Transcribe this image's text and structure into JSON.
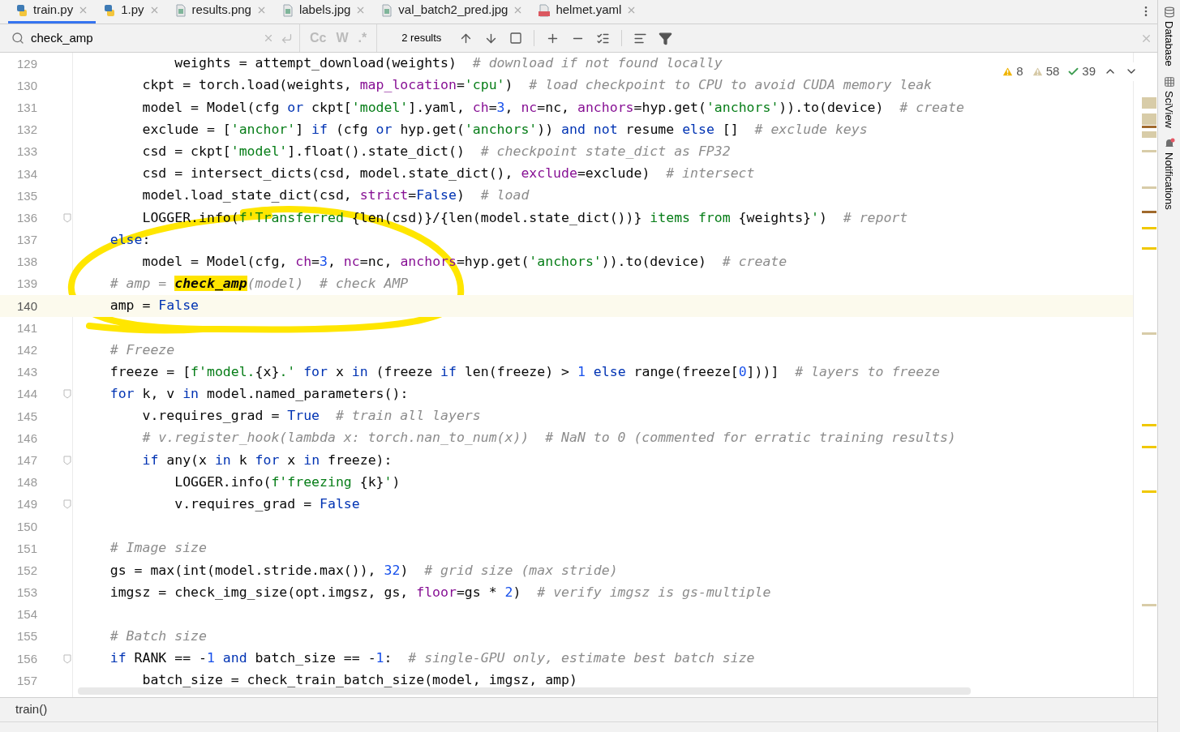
{
  "tabs": [
    {
      "label": "train.py",
      "kind": "python",
      "selected": true
    },
    {
      "label": "1.py",
      "kind": "python",
      "selected": false
    },
    {
      "label": "results.png",
      "kind": "image",
      "selected": false
    },
    {
      "label": "labels.jpg",
      "kind": "image",
      "selected": false
    },
    {
      "label": "val_batch2_pred.jpg",
      "kind": "image",
      "selected": false
    },
    {
      "label": "helmet.yaml",
      "kind": "yaml",
      "selected": false
    }
  ],
  "search": {
    "value": "check_amp",
    "options": [
      "Cc",
      "W",
      ".*"
    ],
    "results": "2 results"
  },
  "inspections": [
    {
      "kind": "warning",
      "count": "8"
    },
    {
      "kind": "weak-warning",
      "count": "58"
    },
    {
      "kind": "typo",
      "count": "39"
    }
  ],
  "lines": [
    {
      "number": "129",
      "current": false,
      "fold": false,
      "tokens": [
        {
          "kind": "plain",
          "text": "            weights = attempt_download(weights)  "
        },
        {
          "kind": "comment",
          "text": "# download if not found locally"
        }
      ]
    },
    {
      "number": "130",
      "current": false,
      "fold": false,
      "tokens": [
        {
          "kind": "plain",
          "text": "        ckpt = torch.load(weights, "
        },
        {
          "kind": "param",
          "text": "map_location"
        },
        {
          "kind": "plain",
          "text": "="
        },
        {
          "kind": "str",
          "text": "'cpu'"
        },
        {
          "kind": "plain",
          "text": ")  "
        },
        {
          "kind": "comment",
          "text": "# load checkpoint to CPU to avoid CUDA memory leak"
        }
      ]
    },
    {
      "number": "131",
      "current": false,
      "fold": false,
      "tokens": [
        {
          "kind": "plain",
          "text": "        model = Model(cfg "
        },
        {
          "kind": "kw",
          "text": "or"
        },
        {
          "kind": "plain",
          "text": " ckpt["
        },
        {
          "kind": "str",
          "text": "'model'"
        },
        {
          "kind": "plain",
          "text": "].yaml, "
        },
        {
          "kind": "param",
          "text": "ch"
        },
        {
          "kind": "plain",
          "text": "="
        },
        {
          "kind": "num",
          "text": "3"
        },
        {
          "kind": "plain",
          "text": ", "
        },
        {
          "kind": "param",
          "text": "nc"
        },
        {
          "kind": "plain",
          "text": "=nc, "
        },
        {
          "kind": "param",
          "text": "anchors"
        },
        {
          "kind": "plain",
          "text": "=hyp.get("
        },
        {
          "kind": "str",
          "text": "'anchors'"
        },
        {
          "kind": "plain",
          "text": ")).to(device)  "
        },
        {
          "kind": "comment",
          "text": "# create"
        }
      ]
    },
    {
      "number": "132",
      "current": false,
      "fold": false,
      "tokens": [
        {
          "kind": "plain",
          "text": "        exclude = ["
        },
        {
          "kind": "str",
          "text": "'anchor'"
        },
        {
          "kind": "plain",
          "text": "] "
        },
        {
          "kind": "kw",
          "text": "if"
        },
        {
          "kind": "plain",
          "text": " (cfg "
        },
        {
          "kind": "kw",
          "text": "or"
        },
        {
          "kind": "plain",
          "text": " hyp.get("
        },
        {
          "kind": "str",
          "text": "'anchors'"
        },
        {
          "kind": "plain",
          "text": ")) "
        },
        {
          "kind": "kw",
          "text": "and not"
        },
        {
          "kind": "plain",
          "text": " resume "
        },
        {
          "kind": "kw",
          "text": "else"
        },
        {
          "kind": "plain",
          "text": " []  "
        },
        {
          "kind": "comment",
          "text": "# exclude keys"
        }
      ]
    },
    {
      "number": "133",
      "current": false,
      "fold": false,
      "tokens": [
        {
          "kind": "plain",
          "text": "        csd = ckpt["
        },
        {
          "kind": "str",
          "text": "'model'"
        },
        {
          "kind": "plain",
          "text": "].float().state_dict()  "
        },
        {
          "kind": "comment",
          "text": "# checkpoint state_dict as FP32"
        }
      ]
    },
    {
      "number": "134",
      "current": false,
      "fold": false,
      "tokens": [
        {
          "kind": "plain",
          "text": "        csd = intersect_dicts(csd, model.state_dict(), "
        },
        {
          "kind": "param",
          "text": "exclude"
        },
        {
          "kind": "plain",
          "text": "=exclude)  "
        },
        {
          "kind": "comment",
          "text": "# intersect"
        }
      ]
    },
    {
      "number": "135",
      "current": false,
      "fold": false,
      "tokens": [
        {
          "kind": "plain",
          "text": "        model.load_state_dict(csd, "
        },
        {
          "kind": "param",
          "text": "strict"
        },
        {
          "kind": "plain",
          "text": "="
        },
        {
          "kind": "kw",
          "text": "False"
        },
        {
          "kind": "plain",
          "text": ")  "
        },
        {
          "kind": "comment",
          "text": "# load"
        }
      ]
    },
    {
      "number": "136",
      "current": false,
      "fold": true,
      "tokens": [
        {
          "kind": "plain",
          "text": "        LOGGER.info("
        },
        {
          "kind": "str",
          "text": "f'Transferred "
        },
        {
          "kind": "plain",
          "text": "{len(csd)}/{len(model.state_dict())}"
        },
        {
          "kind": "str",
          "text": " items from "
        },
        {
          "kind": "plain",
          "text": "{weights}"
        },
        {
          "kind": "str",
          "text": "'"
        },
        {
          "kind": "plain",
          "text": ")  "
        },
        {
          "kind": "comment",
          "text": "# report"
        }
      ]
    },
    {
      "number": "137",
      "current": false,
      "fold": false,
      "tokens": [
        {
          "kind": "kw",
          "text": "    else"
        },
        {
          "kind": "plain",
          "text": ":"
        }
      ]
    },
    {
      "number": "138",
      "current": false,
      "fold": false,
      "tokens": [
        {
          "kind": "plain",
          "text": "        model = Model(cfg, "
        },
        {
          "kind": "param",
          "text": "ch"
        },
        {
          "kind": "plain",
          "text": "="
        },
        {
          "kind": "num",
          "text": "3"
        },
        {
          "kind": "plain",
          "text": ", "
        },
        {
          "kind": "param",
          "text": "nc"
        },
        {
          "kind": "plain",
          "text": "=nc, "
        },
        {
          "kind": "param",
          "text": "anchors"
        },
        {
          "kind": "plain",
          "text": "=hyp.get("
        },
        {
          "kind": "str",
          "text": "'anchors'"
        },
        {
          "kind": "plain",
          "text": ")).to(device)  "
        },
        {
          "kind": "comment",
          "text": "# create"
        }
      ]
    },
    {
      "number": "139",
      "current": false,
      "fold": false,
      "tokens": [
        {
          "kind": "comment",
          "text": "    # amp = "
        },
        {
          "kind": "match",
          "text": "check_amp"
        },
        {
          "kind": "comment",
          "text": "(model)  # check AMP"
        }
      ]
    },
    {
      "number": "140",
      "current": true,
      "fold": false,
      "tokens": [
        {
          "kind": "plain",
          "text": "    amp = "
        },
        {
          "kind": "kw",
          "text": "False"
        }
      ]
    },
    {
      "number": "141",
      "current": false,
      "fold": false
    },
    {
      "number": "142",
      "current": false,
      "fold": false,
      "tokens": [
        {
          "kind": "comment",
          "text": "    # Freeze"
        }
      ]
    },
    {
      "number": "143",
      "current": false,
      "fold": false,
      "tokens": [
        {
          "kind": "plain",
          "text": "    freeze = ["
        },
        {
          "kind": "str",
          "text": "f'model."
        },
        {
          "kind": "plain",
          "text": "{x}"
        },
        {
          "kind": "str",
          "text": ".'"
        },
        {
          "kind": "kw",
          "text": " for"
        },
        {
          "kind": "plain",
          "text": " x "
        },
        {
          "kind": "kw",
          "text": "in"
        },
        {
          "kind": "plain",
          "text": " (freeze "
        },
        {
          "kind": "kw",
          "text": "if"
        },
        {
          "kind": "plain",
          "text": " len(freeze) > "
        },
        {
          "kind": "num",
          "text": "1"
        },
        {
          "kind": "kw",
          "text": " else"
        },
        {
          "kind": "plain",
          "text": " range(freeze["
        },
        {
          "kind": "num",
          "text": "0"
        },
        {
          "kind": "plain",
          "text": "]))]  "
        },
        {
          "kind": "comment",
          "text": "# layers to freeze"
        }
      ]
    },
    {
      "number": "144",
      "current": false,
      "fold": true,
      "tokens": [
        {
          "kind": "kw",
          "text": "    for"
        },
        {
          "kind": "plain",
          "text": " k, v "
        },
        {
          "kind": "kw",
          "text": "in"
        },
        {
          "kind": "plain",
          "text": " model.named_parameters():"
        }
      ]
    },
    {
      "number": "145",
      "current": false,
      "fold": false,
      "tokens": [
        {
          "kind": "plain",
          "text": "        v.requires_grad = "
        },
        {
          "kind": "kw",
          "text": "True"
        },
        {
          "kind": "comment",
          "text": "  # train all layers"
        }
      ]
    },
    {
      "number": "146",
      "current": false,
      "fold": false,
      "tokens": [
        {
          "kind": "comment",
          "text": "        # v.register_hook(lambda x: torch.nan_to_num(x))  # NaN to 0 (commented for erratic training results)"
        }
      ]
    },
    {
      "number": "147",
      "current": false,
      "fold": true,
      "tokens": [
        {
          "kind": "kw",
          "text": "        if"
        },
        {
          "kind": "plain",
          "text": " any(x "
        },
        {
          "kind": "kw",
          "text": "in"
        },
        {
          "kind": "plain",
          "text": " k "
        },
        {
          "kind": "kw",
          "text": "for"
        },
        {
          "kind": "plain",
          "text": " x "
        },
        {
          "kind": "kw",
          "text": "in"
        },
        {
          "kind": "plain",
          "text": " freeze):"
        }
      ]
    },
    {
      "number": "148",
      "current": false,
      "fold": false,
      "tokens": [
        {
          "kind": "plain",
          "text": "            LOGGER.info("
        },
        {
          "kind": "str",
          "text": "f'freezing "
        },
        {
          "kind": "plain",
          "text": "{k}"
        },
        {
          "kind": "str",
          "text": "'"
        },
        {
          "kind": "plain",
          "text": ")"
        }
      ]
    },
    {
      "number": "149",
      "current": false,
      "fold": true,
      "tokens": [
        {
          "kind": "plain",
          "text": "            v.requires_grad = "
        },
        {
          "kind": "kw",
          "text": "False"
        }
      ]
    },
    {
      "number": "150",
      "current": false,
      "fold": false
    },
    {
      "number": "151",
      "current": false,
      "fold": false,
      "tokens": [
        {
          "kind": "comment",
          "text": "    # Image size"
        }
      ]
    },
    {
      "number": "152",
      "current": false,
      "fold": false,
      "tokens": [
        {
          "kind": "plain",
          "text": "    gs = max(int(model.stride.max()), "
        },
        {
          "kind": "num",
          "text": "32"
        },
        {
          "kind": "plain",
          "text": ")  "
        },
        {
          "kind": "comment",
          "text": "# grid size (max stride)"
        }
      ]
    },
    {
      "number": "153",
      "current": false,
      "fold": false,
      "tokens": [
        {
          "kind": "plain",
          "text": "    imgsz = check_img_size(opt.imgsz, gs, "
        },
        {
          "kind": "param",
          "text": "floor"
        },
        {
          "kind": "plain",
          "text": "=gs * "
        },
        {
          "kind": "num",
          "text": "2"
        },
        {
          "kind": "plain",
          "text": ")  "
        },
        {
          "kind": "comment",
          "text": "# verify imgsz is gs-multiple"
        }
      ]
    },
    {
      "number": "154",
      "current": false,
      "fold": false
    },
    {
      "number": "155",
      "current": false,
      "fold": false,
      "tokens": [
        {
          "kind": "comment",
          "text": "    # Batch size"
        }
      ]
    },
    {
      "number": "156",
      "current": false,
      "fold": true,
      "tokens": [
        {
          "kind": "kw",
          "text": "    if"
        },
        {
          "kind": "plain",
          "text": " RANK == -"
        },
        {
          "kind": "num",
          "text": "1"
        },
        {
          "kind": "kw",
          "text": " and"
        },
        {
          "kind": "plain",
          "text": " batch_size == -"
        },
        {
          "kind": "num",
          "text": "1"
        },
        {
          "kind": "plain",
          "text": ":  "
        },
        {
          "kind": "comment",
          "text": "# single-GPU only, estimate best batch size"
        }
      ]
    },
    {
      "number": "157",
      "current": false,
      "fold": false,
      "tokens": [
        {
          "kind": "plain",
          "text": "        batch_size = check_train_batch_size(model, imgsz, amp)"
        }
      ]
    }
  ],
  "right_sidebar": [
    {
      "label": "Database",
      "kind": "database"
    },
    {
      "label": "SciView",
      "kind": "grid"
    },
    {
      "label": "Notifications",
      "kind": "bell"
    }
  ],
  "breadcrumb": "train()"
}
